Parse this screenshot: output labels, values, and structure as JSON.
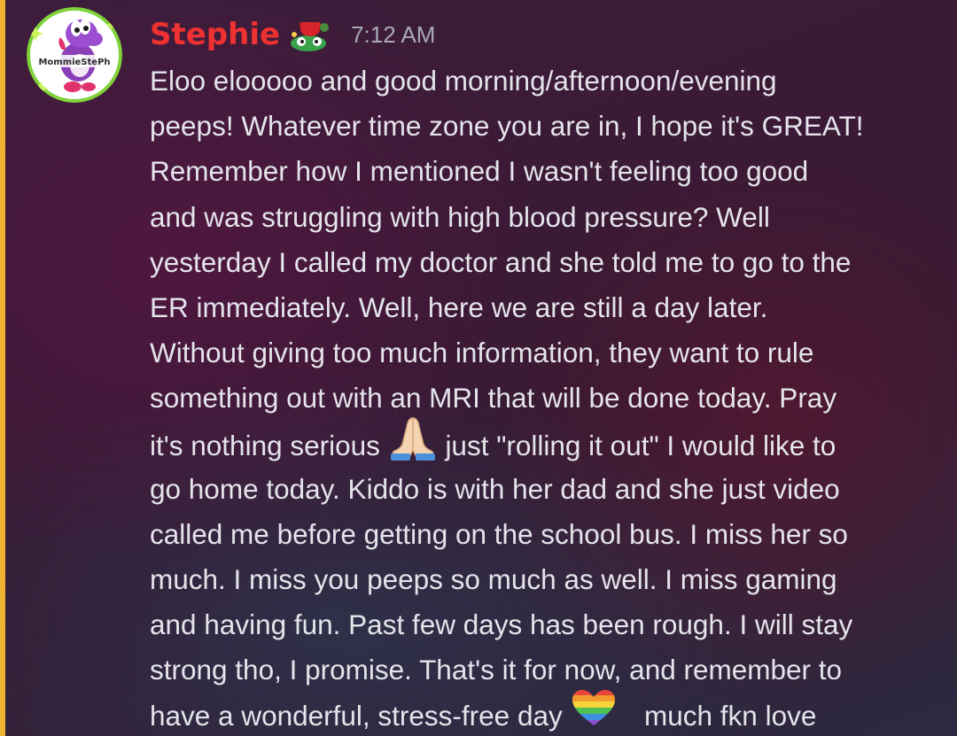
{
  "message": {
    "author": "Stephie",
    "author_color": "#ee3131",
    "role_icon": "yoshi-mario-icon",
    "avatar_icon": "purple-yoshi-avatar-icon",
    "avatar_text": "MommieStePh",
    "timestamp": "7:12 AM",
    "accent_color": "#f0b232",
    "content": {
      "l1": "Eloo elooooo and good morning/afternoon/evening",
      "l2": "peeps! Whatever time zone you are in, I hope it's GREAT!",
      "l3": "Remember how I mentioned I wasn't feeling too good",
      "l4": "and was struggling with high blood pressure? Well",
      "l5": "yesterday I called my doctor and she told me to go to the",
      "l6": "ER immediately. Well, here we are still a day later.",
      "l7": "Without giving too much information, they want to rule",
      "l8": "something out with an MRI that will be done today. Pray",
      "l9_a": "it's nothing serious",
      "l9_emoji": "folded-hands-emoji",
      "l9_b": "just \"rolling it out\" I would like to",
      "l10": "go home today. Kiddo is with her dad and she just video",
      "l11": "called me before getting on the school bus. I miss her so",
      "l12": "much. I miss you peeps so much as well. I miss gaming",
      "l13": "and having fun. Past few days has been rough. I will stay",
      "l14": "strong tho, I promise. That's it for now, and remember to",
      "l15_a": "have a wonderful, stress-free day",
      "l15_emoji": "rainbow-heart-emoji",
      "l15_b": "much fkn love"
    }
  }
}
